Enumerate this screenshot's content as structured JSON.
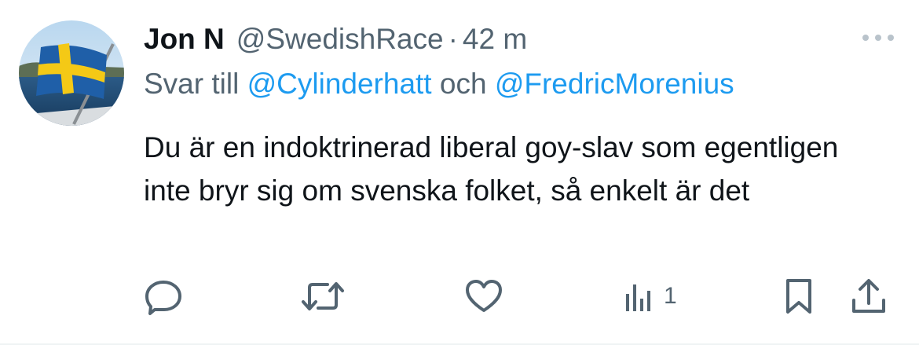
{
  "tweet": {
    "author": {
      "display_name": "Jon N",
      "handle": "@SwedishRace",
      "avatar_icon": "swedish-flag-avatar"
    },
    "separator": "·",
    "timestamp": "42 m",
    "reply": {
      "prefix": "Svar till",
      "mention_1": "@Cylinderhatt",
      "conjunction": "och",
      "mention_2": "@FredricMorenius"
    },
    "text": "Du är en indoktrinerad liberal goy-slav som egentligen inte bryr sig om svenska folket, så enkelt är det",
    "actions": {
      "reply_icon": "reply-icon",
      "retweet_icon": "retweet-icon",
      "like_icon": "heart-icon",
      "views_icon": "views-icon",
      "views_count": "1",
      "bookmark_icon": "bookmark-icon",
      "share_icon": "share-icon"
    }
  },
  "colors": {
    "primary_text": "#0f1419",
    "secondary_text": "#536471",
    "link": "#1d9bf0",
    "divider": "#eff3f4"
  }
}
